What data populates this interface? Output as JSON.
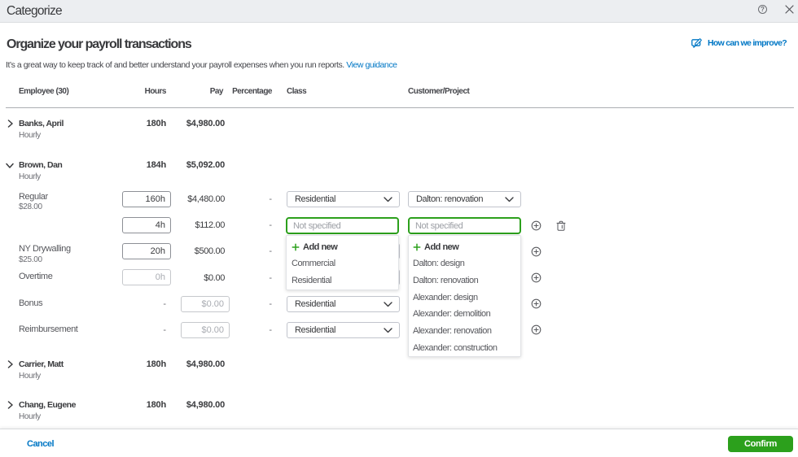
{
  "window": {
    "title": "Categorize"
  },
  "icons": {
    "help": "?"
  },
  "header": {
    "title": "Organize your payroll transactions",
    "subtitle": "It’s a great way to keep track of and better understand your payroll expenses when you run reports.",
    "guidance_link": "View guidance",
    "improve_link": "How can we improve?"
  },
  "table": {
    "columns": {
      "employee": "Employee (30)",
      "hours": "Hours",
      "pay": "Pay",
      "percentage": "Percentage",
      "class": "Class",
      "customer": "Customer/Project"
    }
  },
  "employees": [
    {
      "name": "Banks, April",
      "type": "Hourly",
      "hours": "180h",
      "pay": "$4,980.00",
      "expanded": false
    },
    {
      "name": "Brown, Dan",
      "type": "Hourly",
      "hours": "184h",
      "pay": "$5,092.00",
      "expanded": true
    },
    {
      "name": "Carrier, Matt",
      "type": "Hourly",
      "hours": "180h",
      "pay": "$4,980.00",
      "expanded": false
    },
    {
      "name": "Chang, Eugene",
      "type": "Hourly",
      "hours": "180h",
      "pay": "$4,980.00",
      "expanded": false
    }
  ],
  "pay_rows": [
    {
      "label": "Regular",
      "rate": "$28.00",
      "hours": "160h",
      "pay": "$4,480.00",
      "percentage": "-",
      "class": "Residential",
      "customer": "Dalton: renovation"
    },
    {
      "hours": "4h",
      "pay": "$112.00",
      "percentage": "-",
      "class_placeholder": "Not specified",
      "customer_placeholder": "Not specified"
    },
    {
      "label": "NY Drywalling",
      "rate": "$25.00",
      "hours": "20h",
      "pay": "$500.00",
      "percentage": "-"
    },
    {
      "label": "Overtime",
      "hours_placeholder": "0h",
      "pay": "$0.00",
      "percentage": "-"
    },
    {
      "label": "Bonus",
      "hours": "-",
      "pay_placeholder": "$0.00",
      "percentage": "-",
      "class": "Residential"
    },
    {
      "label": "Reimbursement",
      "hours": "-",
      "pay_placeholder": "$0.00",
      "percentage": "-",
      "class": "Residential"
    }
  ],
  "menus": {
    "class_menu": {
      "add_new": "Add new",
      "items": [
        "Commercial",
        "Residential"
      ]
    },
    "customer_menu": {
      "add_new": "Add new",
      "items": [
        "Dalton: design",
        "Dalton: renovation",
        "Alexander: design",
        "Alexander: demolition",
        "Alexander: renovation",
        "Alexander: construction"
      ]
    }
  },
  "footer": {
    "cancel": "Cancel",
    "confirm": "Confirm"
  },
  "colors": {
    "accent_green": "#2ca01c",
    "link_blue": "#0077c5",
    "text_dark": "#393a3d",
    "text_gray": "#6b6c72",
    "topbar_bg": "#eceef1"
  }
}
